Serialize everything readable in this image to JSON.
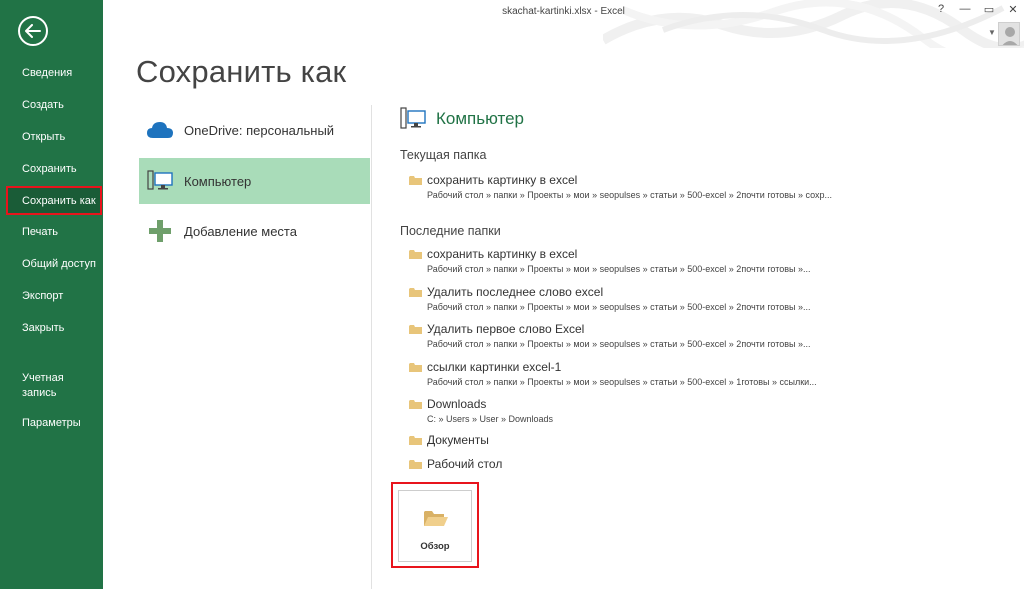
{
  "window": {
    "title": "skachat-kartinki.xlsx - Excel",
    "controls": [
      "?",
      "—",
      "▭",
      "✕"
    ]
  },
  "nav": {
    "items": [
      {
        "label": "Сведения"
      },
      {
        "label": "Создать"
      },
      {
        "label": "Открыть"
      },
      {
        "label": "Сохранить"
      },
      {
        "label": "Сохранить как",
        "active": true
      },
      {
        "label": "Печать"
      },
      {
        "label": "Общий доступ"
      },
      {
        "label": "Экспорт"
      },
      {
        "label": "Закрыть"
      },
      {
        "label": "Учетная запись"
      },
      {
        "label": "Параметры"
      }
    ]
  },
  "page": {
    "title": "Сохранить как"
  },
  "places": [
    {
      "label": "OneDrive: персональный",
      "icon": "cloud-icon"
    },
    {
      "label": "Компьютер",
      "icon": "computer-icon",
      "active": true
    },
    {
      "label": "Добавление места",
      "icon": "plus-icon"
    }
  ],
  "computer": {
    "title": "Компьютер",
    "current_header": "Текущая папка",
    "recent_header": "Последние папки",
    "current_folder": {
      "name": "сохранить картинку в excel",
      "path": "Рабочий стол » папки » Проекты » мои » seopulses » статьи » 500-excel » 2почти готовы » сохр..."
    },
    "recent_folders": [
      {
        "name": "сохранить картинку в excel",
        "path": "Рабочий стол » папки » Проекты » мои » seopulses » статьи » 500-excel » 2почти готовы »..."
      },
      {
        "name": "Удалить последнее слово excel",
        "path": "Рабочий стол » папки » Проекты » мои » seopulses » статьи » 500-excel » 2почти готовы »..."
      },
      {
        "name": "Удалить первое слово Excel",
        "path": "Рабочий стол » папки » Проекты » мои » seopulses » статьи » 500-excel » 2почти готовы »..."
      },
      {
        "name": "ссылки картинки excel-1",
        "path": "Рабочий стол » папки » Проекты » мои » seopulses » статьи » 500-excel » 1готовы » ссылки..."
      },
      {
        "name": "Downloads",
        "path": "C: » Users » User » Downloads"
      },
      {
        "name": "Документы",
        "path": ""
      },
      {
        "name": "Рабочий стол",
        "path": ""
      }
    ],
    "browse_label": "Обзор"
  },
  "colors": {
    "excel_green": "#217346",
    "active_place": "#a9dcb9",
    "highlight_red": "#e8141c",
    "folder": "#e8c57a"
  }
}
